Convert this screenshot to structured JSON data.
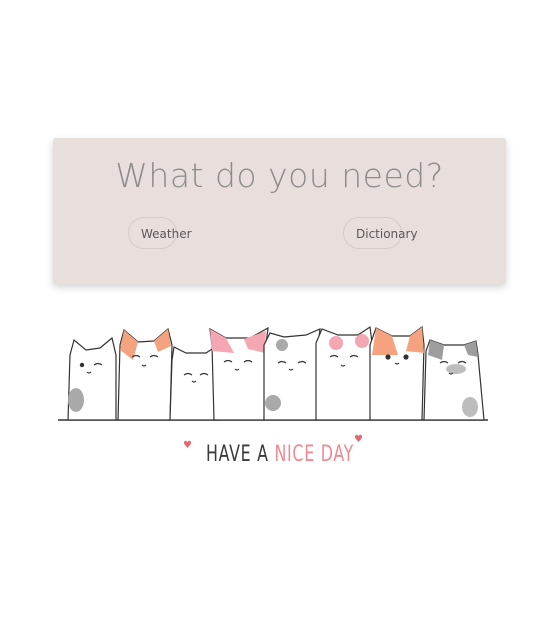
{
  "card": {
    "title": "What do you need?",
    "buttons": {
      "weather": "Weather",
      "dictionary": "Dictionary"
    }
  },
  "banner": {
    "slogan_part1": "HAVE A ",
    "slogan_part2": "NICE DAY"
  },
  "colors": {
    "card_bg": "#e8dedb",
    "accent_pink": "#f08a92",
    "text_grey": "#8c8c8c",
    "heart": "#e7656f"
  },
  "icons": [
    "heart-icon"
  ]
}
